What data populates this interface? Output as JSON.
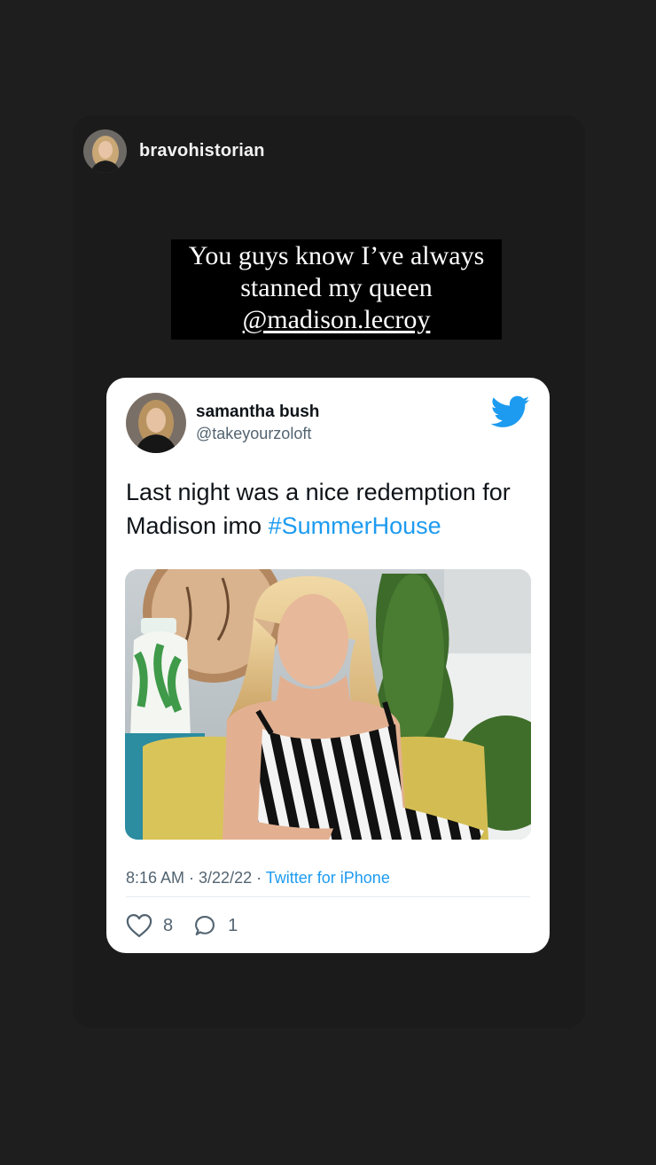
{
  "story": {
    "username": "bravohistorian",
    "caption_lines": [
      "You guys know I’ve always",
      "stanned my queen",
      "@madison.lecroy"
    ]
  },
  "tweet": {
    "display_name": "samantha bush",
    "handle": "@takeyourzoloft",
    "text": "Last night was a nice redemption for Madison imo ",
    "hashtag": "#SummerHouse",
    "time": "8:16 AM · 3/22/22 · ",
    "source": "Twitter for iPhone",
    "likes": "8",
    "replies": "1"
  },
  "icons": {
    "brand": "twitter-bird-icon",
    "like": "heart-icon",
    "reply": "reply-bubble-icon"
  },
  "colors": {
    "background": "#1e1e1e",
    "link_blue": "#1d9bf0",
    "muted_gray": "#536471"
  }
}
